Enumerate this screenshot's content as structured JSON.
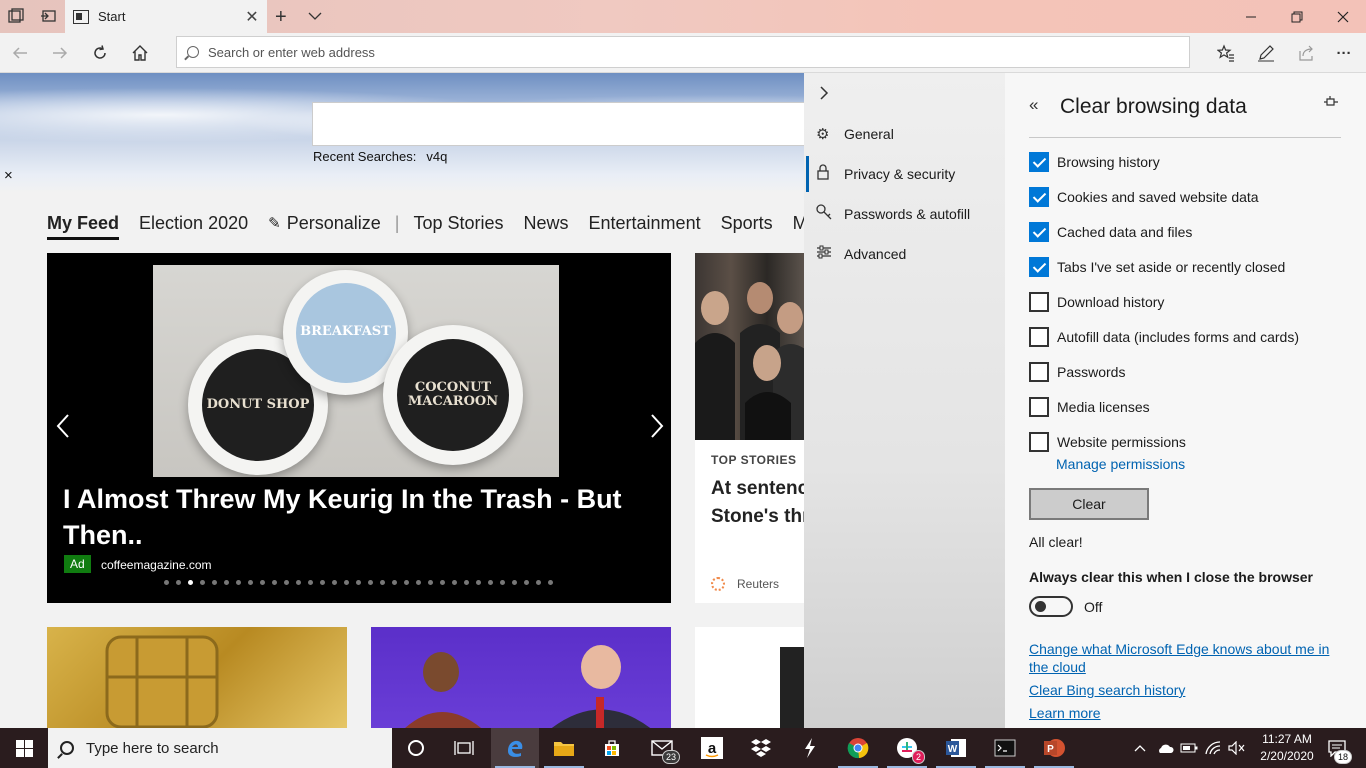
{
  "browser": {
    "tab_title": "Start",
    "address_placeholder": "Search or enter web address"
  },
  "newtab": {
    "recent_label": "Recent Searches:",
    "recent_query": "v4q",
    "close_glyph": "×",
    "feed_tabs": [
      "My Feed",
      "Election 2020",
      "Personalize",
      "Top Stories",
      "News",
      "Entertainment",
      "Sports",
      "M"
    ],
    "main_story": {
      "headline": "I Almost Threw My Keurig In the Trash - But Then..",
      "ad_badge": "Ad",
      "source": "coffeemagazine.com",
      "cup_labels": [
        "DONUT SHOP",
        "BREAKFAST",
        "COCONUT MACAROON"
      ],
      "slide_count": 33,
      "active_slide": 2
    },
    "side_story": {
      "kicker": "TOP STORIES",
      "title": "At sentencing, Stone's thr",
      "source": "Reuters"
    }
  },
  "settings_nav": {
    "items": [
      {
        "label": "General",
        "icon": "gear-icon"
      },
      {
        "label": "Privacy & security",
        "icon": "lock-icon"
      },
      {
        "label": "Passwords & autofill",
        "icon": "key-icon"
      },
      {
        "label": "Advanced",
        "icon": "sliders-icon"
      }
    ],
    "active": "Privacy & security"
  },
  "clear_data": {
    "title": "Clear browsing data",
    "options": [
      {
        "label": "Browsing history",
        "checked": true
      },
      {
        "label": "Cookies and saved website data",
        "checked": true
      },
      {
        "label": "Cached data and files",
        "checked": true
      },
      {
        "label": "Tabs I've set aside or recently closed",
        "checked": true
      },
      {
        "label": "Download history",
        "checked": false
      },
      {
        "label": "Autofill data (includes forms and cards)",
        "checked": false
      },
      {
        "label": "Passwords",
        "checked": false
      },
      {
        "label": "Media licenses",
        "checked": false
      },
      {
        "label": "Website permissions",
        "checked": false
      }
    ],
    "manage_permissions": "Manage permissions",
    "clear_button": "Clear",
    "status": "All clear!",
    "always_clear_label": "Always clear this when I close the browser",
    "toggle_state": "Off",
    "link_cloud": "Change what Microsoft Edge knows about me in the cloud",
    "link_bing": "Clear Bing search history",
    "link_learn": "Learn more"
  },
  "taskbar": {
    "search_placeholder": "Type here to search",
    "mail_badge": "23",
    "slack_badge": "2",
    "notification_count": "18",
    "time": "11:27 AM",
    "date": "2/20/2020"
  },
  "colors": {
    "accent": "#0078d7",
    "link": "#0063b1",
    "ad_green": "#107c10",
    "taskbar": "#2a1c1e"
  }
}
